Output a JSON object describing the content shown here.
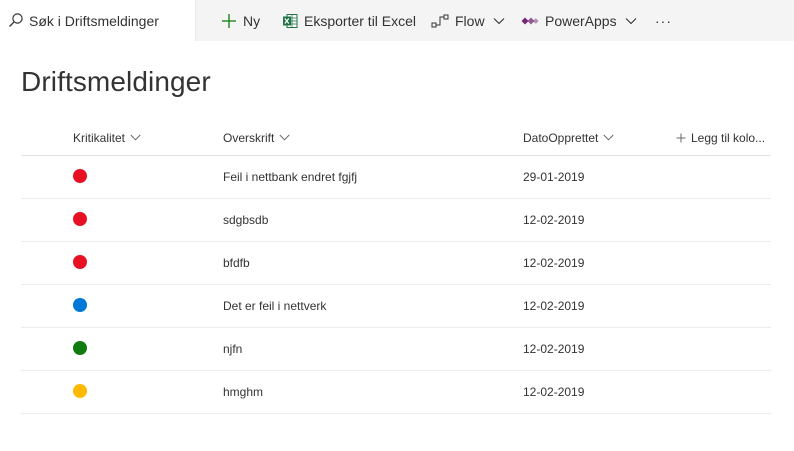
{
  "search": {
    "placeholder": "Søk i Driftsmeldinger"
  },
  "commands": {
    "new_label": "Ny",
    "export_label": "Eksporter til Excel",
    "flow_label": "Flow",
    "powerapps_label": "PowerApps",
    "more_label": "···"
  },
  "page": {
    "title": "Driftsmeldinger"
  },
  "columns": {
    "kritikalitet": "Kritikalitet",
    "overskrift": "Overskrift",
    "dato": "DatoOpprettet",
    "add_column": "Legg til kolo..."
  },
  "rows": [
    {
      "color": "#e81123",
      "title": "Feil i nettbank endret fgjfj",
      "date": "29-01-2019"
    },
    {
      "color": "#e81123",
      "title": "sdgbsdb",
      "date": "12-02-2019"
    },
    {
      "color": "#e81123",
      "title": "bfdfb",
      "date": "12-02-2019"
    },
    {
      "color": "#0078d7",
      "title": "Det er feil i nettverk",
      "date": "12-02-2019"
    },
    {
      "color": "#107c10",
      "title": "njfn",
      "date": "12-02-2019"
    },
    {
      "color": "#ffb900",
      "title": "hmghm",
      "date": "12-02-2019"
    }
  ],
  "colors": {
    "accent": "#0078d4",
    "excel": "#217346",
    "powerapps": "#742774",
    "chrome": "#f4f4f4"
  },
  "icons": {
    "search": "search-icon",
    "new": "plus-icon",
    "excel": "excel-icon",
    "flow": "flow-icon",
    "powerapps": "powerapps-icon",
    "chevron": "chevron-down-icon",
    "add": "plus-icon"
  }
}
